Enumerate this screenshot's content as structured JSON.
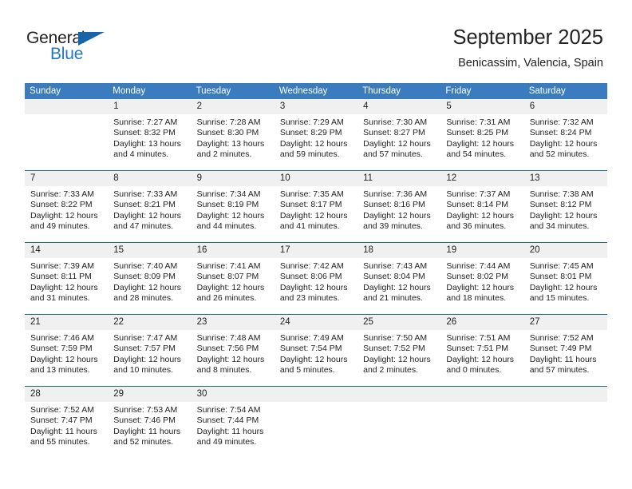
{
  "brand": {
    "name_top": "General",
    "name_bottom": "Blue",
    "accent_color": "#2277c8",
    "triangle_color": "#1565a8",
    "triangle_icon": "triangle-icon"
  },
  "header": {
    "title": "September 2025",
    "location": "Benicassim, Valencia, Spain"
  },
  "theme": {
    "header_row_bg": "#3a7cbe",
    "week_separator": "#1f6bb0",
    "daynum_band_bg": "#f0f0f0",
    "text": "#222222"
  },
  "weekdays": [
    "Sunday",
    "Monday",
    "Tuesday",
    "Wednesday",
    "Thursday",
    "Friday",
    "Saturday"
  ],
  "weeks": [
    {
      "days": [
        {
          "num": "",
          "lines": []
        },
        {
          "num": "1",
          "lines": [
            "Sunrise: 7:27 AM",
            "Sunset: 8:32 PM",
            "Daylight: 13 hours",
            "and 4 minutes."
          ]
        },
        {
          "num": "2",
          "lines": [
            "Sunrise: 7:28 AM",
            "Sunset: 8:30 PM",
            "Daylight: 13 hours",
            "and 2 minutes."
          ]
        },
        {
          "num": "3",
          "lines": [
            "Sunrise: 7:29 AM",
            "Sunset: 8:29 PM",
            "Daylight: 12 hours",
            "and 59 minutes."
          ]
        },
        {
          "num": "4",
          "lines": [
            "Sunrise: 7:30 AM",
            "Sunset: 8:27 PM",
            "Daylight: 12 hours",
            "and 57 minutes."
          ]
        },
        {
          "num": "5",
          "lines": [
            "Sunrise: 7:31 AM",
            "Sunset: 8:25 PM",
            "Daylight: 12 hours",
            "and 54 minutes."
          ]
        },
        {
          "num": "6",
          "lines": [
            "Sunrise: 7:32 AM",
            "Sunset: 8:24 PM",
            "Daylight: 12 hours",
            "and 52 minutes."
          ]
        }
      ]
    },
    {
      "days": [
        {
          "num": "7",
          "lines": [
            "Sunrise: 7:33 AM",
            "Sunset: 8:22 PM",
            "Daylight: 12 hours",
            "and 49 minutes."
          ]
        },
        {
          "num": "8",
          "lines": [
            "Sunrise: 7:33 AM",
            "Sunset: 8:21 PM",
            "Daylight: 12 hours",
            "and 47 minutes."
          ]
        },
        {
          "num": "9",
          "lines": [
            "Sunrise: 7:34 AM",
            "Sunset: 8:19 PM",
            "Daylight: 12 hours",
            "and 44 minutes."
          ]
        },
        {
          "num": "10",
          "lines": [
            "Sunrise: 7:35 AM",
            "Sunset: 8:17 PM",
            "Daylight: 12 hours",
            "and 41 minutes."
          ]
        },
        {
          "num": "11",
          "lines": [
            "Sunrise: 7:36 AM",
            "Sunset: 8:16 PM",
            "Daylight: 12 hours",
            "and 39 minutes."
          ]
        },
        {
          "num": "12",
          "lines": [
            "Sunrise: 7:37 AM",
            "Sunset: 8:14 PM",
            "Daylight: 12 hours",
            "and 36 minutes."
          ]
        },
        {
          "num": "13",
          "lines": [
            "Sunrise: 7:38 AM",
            "Sunset: 8:12 PM",
            "Daylight: 12 hours",
            "and 34 minutes."
          ]
        }
      ]
    },
    {
      "days": [
        {
          "num": "14",
          "lines": [
            "Sunrise: 7:39 AM",
            "Sunset: 8:11 PM",
            "Daylight: 12 hours",
            "and 31 minutes."
          ]
        },
        {
          "num": "15",
          "lines": [
            "Sunrise: 7:40 AM",
            "Sunset: 8:09 PM",
            "Daylight: 12 hours",
            "and 28 minutes."
          ]
        },
        {
          "num": "16",
          "lines": [
            "Sunrise: 7:41 AM",
            "Sunset: 8:07 PM",
            "Daylight: 12 hours",
            "and 26 minutes."
          ]
        },
        {
          "num": "17",
          "lines": [
            "Sunrise: 7:42 AM",
            "Sunset: 8:06 PM",
            "Daylight: 12 hours",
            "and 23 minutes."
          ]
        },
        {
          "num": "18",
          "lines": [
            "Sunrise: 7:43 AM",
            "Sunset: 8:04 PM",
            "Daylight: 12 hours",
            "and 21 minutes."
          ]
        },
        {
          "num": "19",
          "lines": [
            "Sunrise: 7:44 AM",
            "Sunset: 8:02 PM",
            "Daylight: 12 hours",
            "and 18 minutes."
          ]
        },
        {
          "num": "20",
          "lines": [
            "Sunrise: 7:45 AM",
            "Sunset: 8:01 PM",
            "Daylight: 12 hours",
            "and 15 minutes."
          ]
        }
      ]
    },
    {
      "days": [
        {
          "num": "21",
          "lines": [
            "Sunrise: 7:46 AM",
            "Sunset: 7:59 PM",
            "Daylight: 12 hours",
            "and 13 minutes."
          ]
        },
        {
          "num": "22",
          "lines": [
            "Sunrise: 7:47 AM",
            "Sunset: 7:57 PM",
            "Daylight: 12 hours",
            "and 10 minutes."
          ]
        },
        {
          "num": "23",
          "lines": [
            "Sunrise: 7:48 AM",
            "Sunset: 7:56 PM",
            "Daylight: 12 hours",
            "and 8 minutes."
          ]
        },
        {
          "num": "24",
          "lines": [
            "Sunrise: 7:49 AM",
            "Sunset: 7:54 PM",
            "Daylight: 12 hours",
            "and 5 minutes."
          ]
        },
        {
          "num": "25",
          "lines": [
            "Sunrise: 7:50 AM",
            "Sunset: 7:52 PM",
            "Daylight: 12 hours",
            "and 2 minutes."
          ]
        },
        {
          "num": "26",
          "lines": [
            "Sunrise: 7:51 AM",
            "Sunset: 7:51 PM",
            "Daylight: 12 hours",
            "and 0 minutes."
          ]
        },
        {
          "num": "27",
          "lines": [
            "Sunrise: 7:52 AM",
            "Sunset: 7:49 PM",
            "Daylight: 11 hours",
            "and 57 minutes."
          ]
        }
      ]
    },
    {
      "days": [
        {
          "num": "28",
          "lines": [
            "Sunrise: 7:52 AM",
            "Sunset: 7:47 PM",
            "Daylight: 11 hours",
            "and 55 minutes."
          ]
        },
        {
          "num": "29",
          "lines": [
            "Sunrise: 7:53 AM",
            "Sunset: 7:46 PM",
            "Daylight: 11 hours",
            "and 52 minutes."
          ]
        },
        {
          "num": "30",
          "lines": [
            "Sunrise: 7:54 AM",
            "Sunset: 7:44 PM",
            "Daylight: 11 hours",
            "and 49 minutes."
          ]
        },
        {
          "num": "",
          "lines": []
        },
        {
          "num": "",
          "lines": []
        },
        {
          "num": "",
          "lines": []
        },
        {
          "num": "",
          "lines": []
        }
      ]
    }
  ]
}
